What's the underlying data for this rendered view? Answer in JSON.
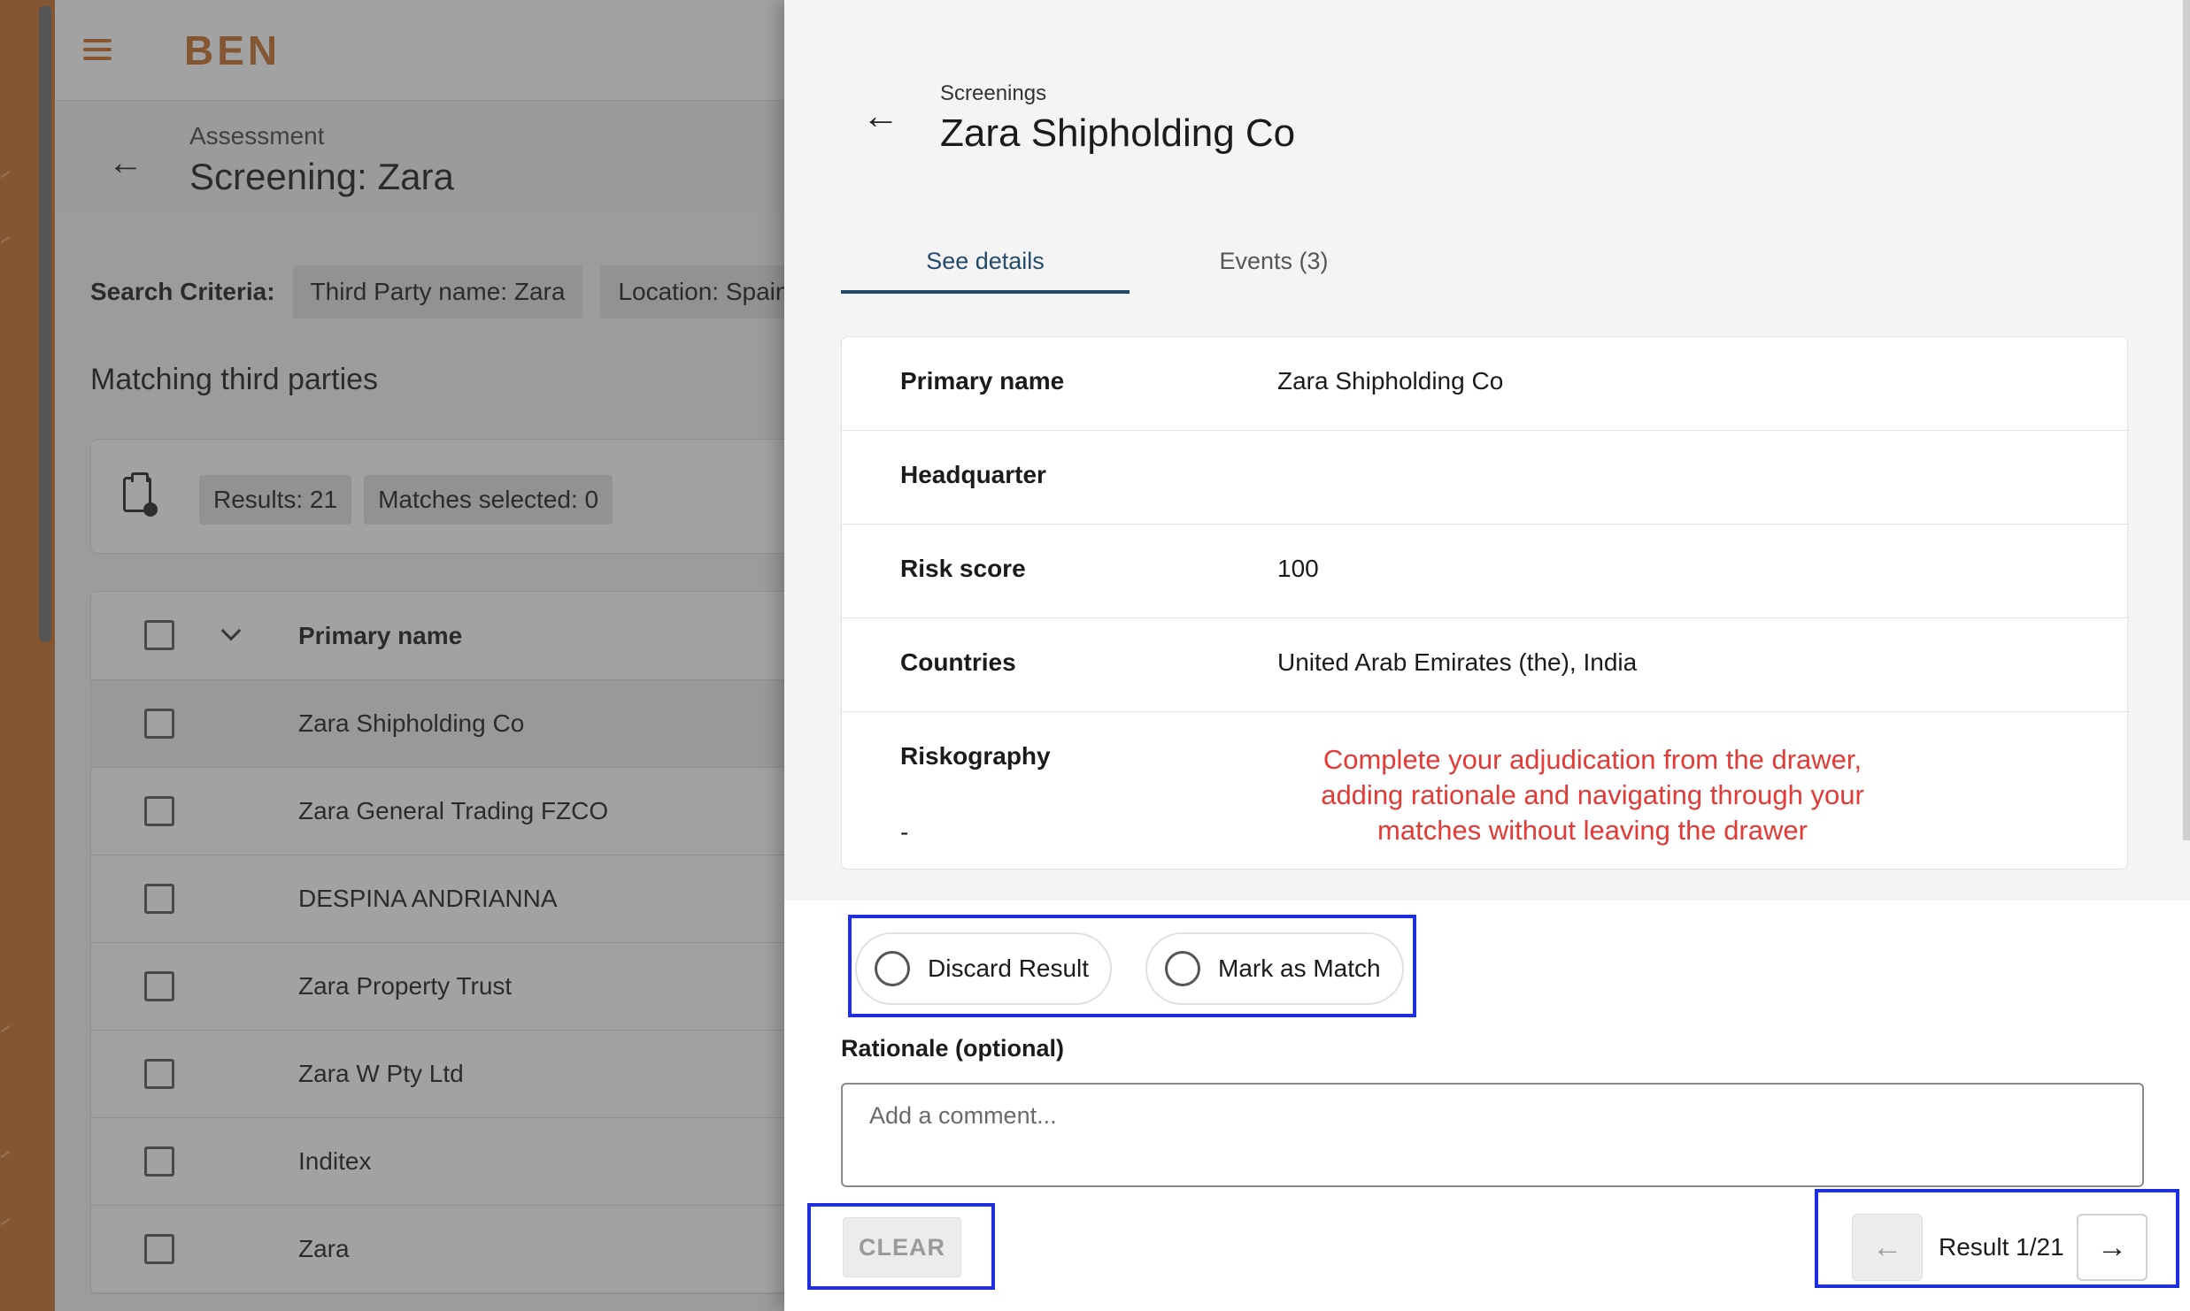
{
  "app": {
    "brand": "BEN",
    "header": {
      "eyebrow": "Assessment",
      "title": "Screening: Zara"
    },
    "search_criteria": {
      "label": "Search Criteria:",
      "chips": [
        "Third Party name: Zara",
        "Location: Spain"
      ]
    },
    "section_title": "Matching third parties",
    "summary": {
      "results": "Results: 21",
      "matches_selected": "Matches selected: 0"
    },
    "table": {
      "column_header": "Primary name",
      "rows": [
        "Zara Shipholding Co",
        "Zara General Trading FZCO",
        "DESPINA ANDRIANNA",
        "Zara Property Trust",
        "Zara W Pty Ltd",
        "Inditex",
        "Zara"
      ]
    }
  },
  "drawer": {
    "eyebrow": "Screenings",
    "title": "Zara Shipholding Co",
    "tabs": [
      "See details",
      "Events (3)"
    ],
    "details": [
      {
        "label": "Primary name",
        "value": "Zara Shipholding Co"
      },
      {
        "label": "Headquarter",
        "value": ""
      },
      {
        "label": "Risk score",
        "value": "100"
      },
      {
        "label": "Countries",
        "value": "United Arab Emirates (the), India"
      },
      {
        "label": "Riskography",
        "value": "-"
      }
    ],
    "annotation": "Complete your adjudication from the drawer, adding rationale and navigating through your matches without leaving the drawer",
    "options": [
      "Discard Result",
      "Mark as Match"
    ],
    "rationale_label": "Rationale (optional)",
    "comment_placeholder": "Add a comment...",
    "clear_label": "CLEAR",
    "pager": {
      "label": "Result 1/21"
    }
  },
  "colors": {
    "brand": "#c86d2a",
    "tab_active": "#24496a",
    "annotation": "#e53935",
    "highlight_box": "#1f2fe0"
  },
  "icons": [
    "menu-icon",
    "back-arrow-icon",
    "clipboard-clock-icon",
    "chevron-down-icon",
    "arrow-left-icon",
    "arrow-right-icon"
  ]
}
